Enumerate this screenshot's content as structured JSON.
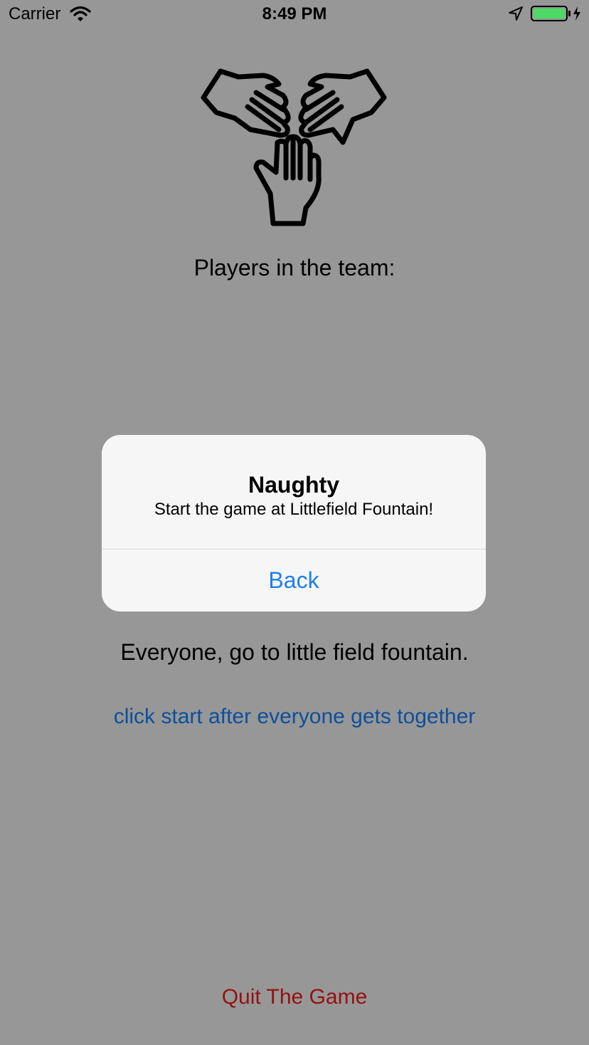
{
  "status_bar": {
    "carrier": "Carrier",
    "time": "8:49 PM",
    "icons": [
      "wifi-icon",
      "location-arrow-icon",
      "battery-charging-icon"
    ],
    "battery_color": "#4cd964"
  },
  "main": {
    "logo_icon": "team-hands-icon",
    "team_heading": "Players in the team:",
    "instruction": "Everyone, go to little field fountain.",
    "start_link": "click start after everyone gets together",
    "quit_label": "Quit The Game"
  },
  "alert": {
    "title": "Naughty",
    "message": "Start the game at Littlefield Fountain!",
    "button_label": "Back"
  },
  "colors": {
    "background_dimmed": "#979797",
    "link_blue": "#0d4f9c",
    "alert_action_blue": "#1e7fe8",
    "quit_red": "#941111"
  }
}
